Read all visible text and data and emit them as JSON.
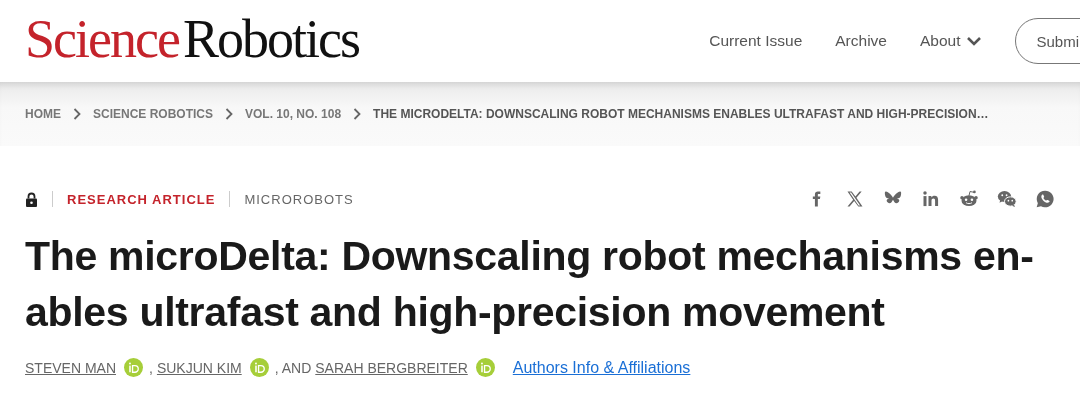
{
  "logo": {
    "first": "Science",
    "second": "Robotics"
  },
  "nav": [
    {
      "label": "Current Issue",
      "kind": "link"
    },
    {
      "label": "Archive",
      "kind": "link"
    },
    {
      "label": "About",
      "kind": "menu"
    }
  ],
  "submit_button": "Submi",
  "breadcrumb": [
    "HOME",
    "SCIENCE ROBOTICS",
    "VOL. 10, NO. 108",
    "THE MICRODELTA: DOWNSCALING ROBOT MECHANISMS ENABLES ULTRAFAST AND HIGH-PRECISION…"
  ],
  "article_type": "RESEARCH ARTICLE",
  "subject": "MICROROBOTS",
  "title_lines": [
    "The microDelta: Downscaling robot mechanisms en-",
    "ables ultrafast and high-precision movement"
  ],
  "authors": [
    {
      "name": "STEVEN MAN",
      "joiner": ","
    },
    {
      "name": "SUKJUN KIM",
      "joiner": ", AND"
    },
    {
      "name": "SARAH BERGBREITER"
    }
  ],
  "affiliations_link": "Authors Info & Affiliations"
}
